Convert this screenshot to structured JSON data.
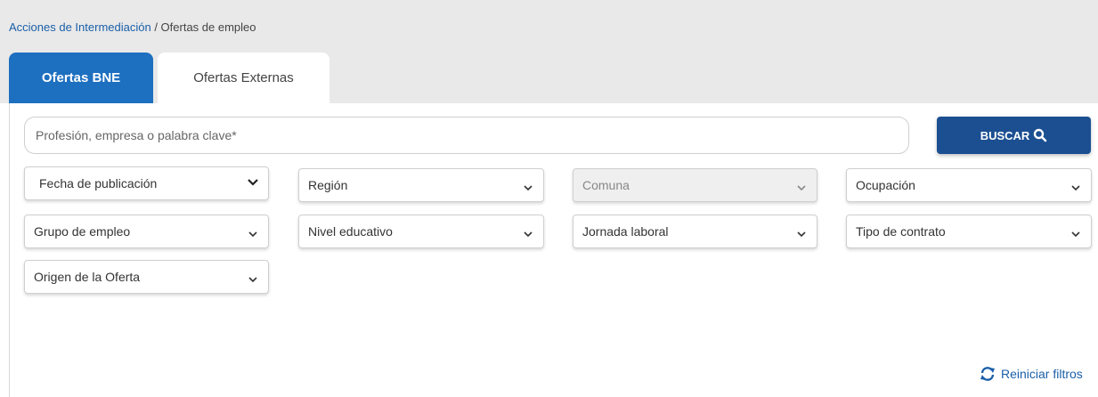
{
  "breadcrumb": {
    "link": "Acciones de Intermediación",
    "separator": " / ",
    "current": "Ofertas de empleo"
  },
  "tabs": [
    {
      "label": "Ofertas BNE",
      "active": true
    },
    {
      "label": "Ofertas Externas",
      "active": false
    }
  ],
  "search": {
    "placeholder": "Profesión, empresa o palabra clave*",
    "button_label": "BUSCAR",
    "button_icon": "search-icon"
  },
  "filters": {
    "fecha": "Fecha de publicación",
    "region": "Región",
    "comuna": "Comuna",
    "ocupacion": "Ocupación",
    "grupo": "Grupo de empleo",
    "nivel": "Nivel educativo",
    "jornada": "Jornada laboral",
    "contrato": "Tipo de contrato",
    "origen": "Origen de la Oferta"
  },
  "reset": {
    "label": "Reiniciar filtros",
    "icon": "refresh-icon"
  },
  "colors": {
    "primary": "#1d6fc0",
    "button": "#1b4f91",
    "link": "#1a5fa8",
    "band": "#e9e9e9"
  }
}
